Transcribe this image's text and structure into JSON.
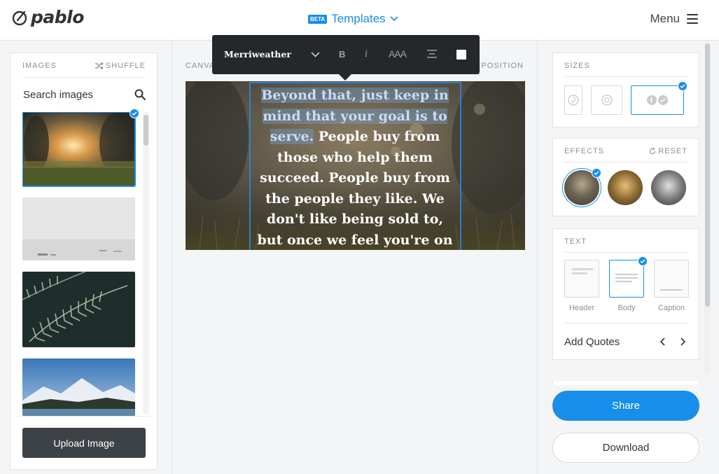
{
  "header": {
    "logo_text": "pablo",
    "beta_badge": "BETA",
    "templates_label": "Templates",
    "menu_label": "Menu"
  },
  "left_panel": {
    "images_label": "IMAGES",
    "shuffle_label": "SHUFFLE",
    "search_placeholder": "Search images",
    "thumbnails": [
      {
        "name": "sunset-field",
        "selected": true
      },
      {
        "name": "foggy-sea-boats",
        "selected": false
      },
      {
        "name": "fern-leaves",
        "selected": false
      },
      {
        "name": "mountain-lake",
        "selected": false
      }
    ],
    "upload_label": "Upload Image"
  },
  "center": {
    "canvas_label": "CANVA",
    "reposition_label": "EPOSITION",
    "quote_highlighted": "Beyond that, just keep in mind that your goal is to serve.",
    "quote_rest": " People buy from those who help them succeed. People buy from the people they like. We don't like being sold to, but once we feel you're on our"
  },
  "toolbar": {
    "font_name": "Merriweather",
    "bold_label": "B",
    "italic_label": "i",
    "size_label": "AAA",
    "color": "#ffffff"
  },
  "right_panel": {
    "sizes_label": "SIZES",
    "effects_label": "EFFECTS",
    "reset_label": "RESET",
    "text_label": "TEXT",
    "text_options": [
      "Header",
      "Body",
      "Caption"
    ],
    "add_quotes_label": "Add Quotes",
    "share_label": "Share",
    "download_label": "Download"
  },
  "colors": {
    "accent": "#168eea",
    "dark_button": "#3d4247",
    "toolbar_bg": "#25282b"
  }
}
